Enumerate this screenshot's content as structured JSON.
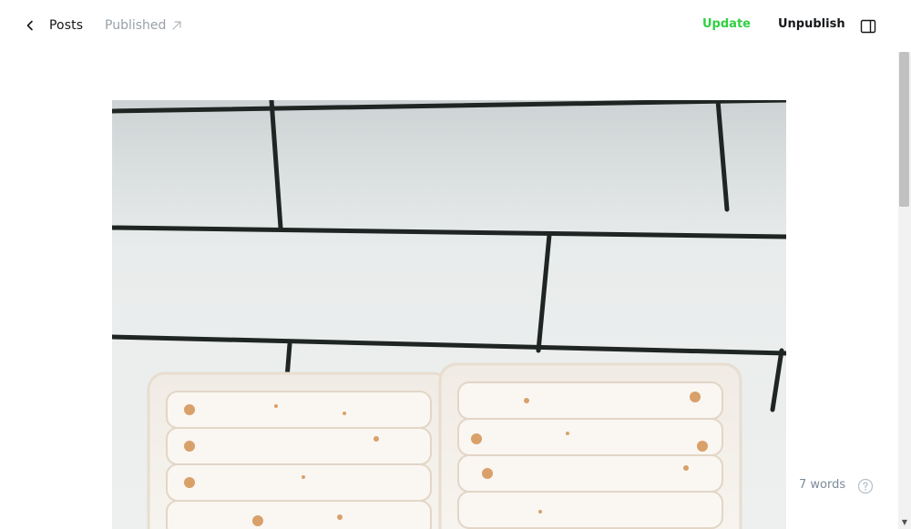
{
  "header": {
    "back_label": "Posts",
    "status_label": "Published",
    "update_label": "Update",
    "unpublish_label": "Unpublish"
  },
  "footer": {
    "word_count": "7 words"
  },
  "icons": {
    "back": "chevron-left-icon",
    "status_link": "arrow-up-right-icon",
    "sidebar": "sidebar-panel-icon",
    "help": "question-circle-icon"
  },
  "colors": {
    "update": "#30cf43",
    "muted": "#99a0a8",
    "text": "#15171a"
  }
}
